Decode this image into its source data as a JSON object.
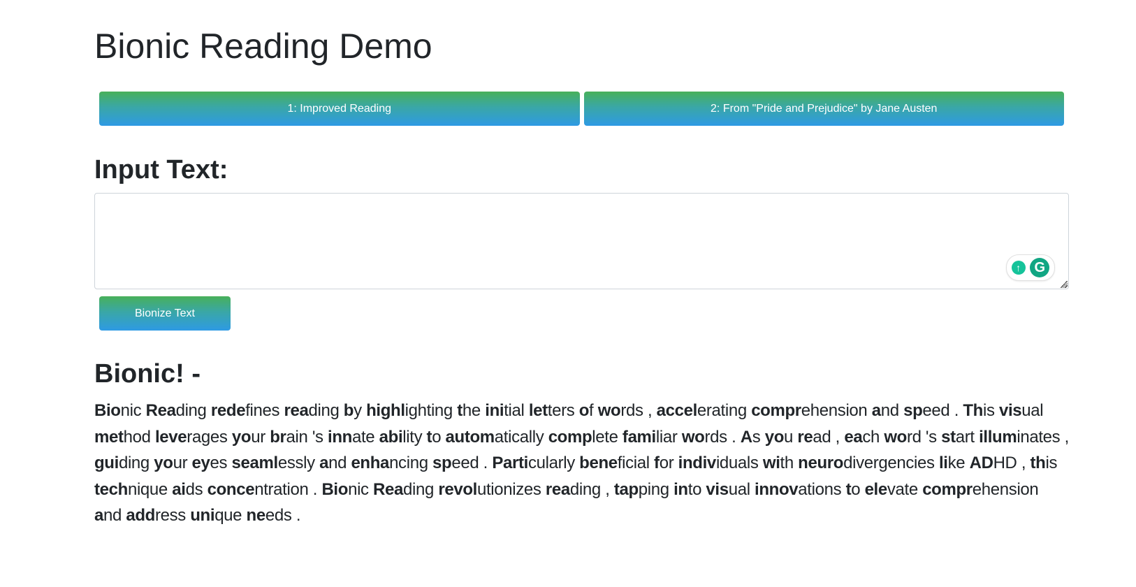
{
  "page": {
    "title": "Bionic Reading Demo"
  },
  "presets": [
    {
      "label": "1: Improved Reading"
    },
    {
      "label": "2: From \"Pride and Prejudice\" by Jane Austen"
    }
  ],
  "input": {
    "heading": "Input Text:",
    "value": "",
    "placeholder": ""
  },
  "grammarly": {
    "bulb_icon": "lightbulb-icon",
    "logo_icon": "grammarly-g-icon",
    "logo_letter": "G",
    "color": "#15c39a"
  },
  "bionize_button": {
    "label": "Bionize Text"
  },
  "output": {
    "heading": "Bionic! -",
    "words": [
      {
        "bold": "Bio",
        "rest": "nic"
      },
      {
        "bold": "Rea",
        "rest": "ding"
      },
      {
        "bold": "rede",
        "rest": "fines"
      },
      {
        "bold": "rea",
        "rest": "ding"
      },
      {
        "bold": "b",
        "rest": "y"
      },
      {
        "bold": "highl",
        "rest": "ighting"
      },
      {
        "bold": "t",
        "rest": "he"
      },
      {
        "bold": "ini",
        "rest": "tial"
      },
      {
        "bold": "let",
        "rest": "ters"
      },
      {
        "bold": "o",
        "rest": "f"
      },
      {
        "bold": "wo",
        "rest": "rds"
      },
      {
        "bold": "",
        "rest": ","
      },
      {
        "bold": "accel",
        "rest": "erating"
      },
      {
        "bold": "compr",
        "rest": "ehension"
      },
      {
        "bold": "a",
        "rest": "nd"
      },
      {
        "bold": "sp",
        "rest": "eed"
      },
      {
        "bold": "",
        "rest": "."
      },
      {
        "bold": "Th",
        "rest": "is"
      },
      {
        "bold": "vis",
        "rest": "ual"
      },
      {
        "bold": "met",
        "rest": "hod"
      },
      {
        "bold": "leve",
        "rest": "rages"
      },
      {
        "bold": "yo",
        "rest": "ur"
      },
      {
        "bold": "br",
        "rest": "ain"
      },
      {
        "bold": "",
        "rest": "'s"
      },
      {
        "bold": "inn",
        "rest": "ate"
      },
      {
        "bold": "abi",
        "rest": "lity"
      },
      {
        "bold": "t",
        "rest": "o"
      },
      {
        "bold": "autom",
        "rest": "atically"
      },
      {
        "bold": "comp",
        "rest": "lete"
      },
      {
        "bold": "fami",
        "rest": "liar"
      },
      {
        "bold": "wo",
        "rest": "rds"
      },
      {
        "bold": "",
        "rest": "."
      },
      {
        "bold": "A",
        "rest": "s"
      },
      {
        "bold": "yo",
        "rest": "u"
      },
      {
        "bold": "re",
        "rest": "ad"
      },
      {
        "bold": "",
        "rest": ","
      },
      {
        "bold": "ea",
        "rest": "ch"
      },
      {
        "bold": "wo",
        "rest": "rd"
      },
      {
        "bold": "",
        "rest": "'s"
      },
      {
        "bold": "st",
        "rest": "art"
      },
      {
        "bold": "illum",
        "rest": "inates"
      },
      {
        "bold": "",
        "rest": ","
      },
      {
        "bold": "gui",
        "rest": "ding"
      },
      {
        "bold": "yo",
        "rest": "ur"
      },
      {
        "bold": "ey",
        "rest": "es"
      },
      {
        "bold": "seaml",
        "rest": "essly"
      },
      {
        "bold": "a",
        "rest": "nd"
      },
      {
        "bold": "enha",
        "rest": "ncing"
      },
      {
        "bold": "sp",
        "rest": "eed"
      },
      {
        "bold": "",
        "rest": "."
      },
      {
        "bold": "Parti",
        "rest": "cularly"
      },
      {
        "bold": "bene",
        "rest": "ficial"
      },
      {
        "bold": "f",
        "rest": "or"
      },
      {
        "bold": "indiv",
        "rest": "iduals"
      },
      {
        "bold": "wi",
        "rest": "th"
      },
      {
        "bold": "neuro",
        "rest": "divergencies"
      },
      {
        "bold": "li",
        "rest": "ke"
      },
      {
        "bold": "AD",
        "rest": "HD"
      },
      {
        "bold": "",
        "rest": ","
      },
      {
        "bold": "th",
        "rest": "is"
      },
      {
        "bold": "tech",
        "rest": "nique"
      },
      {
        "bold": "ai",
        "rest": "ds"
      },
      {
        "bold": "conce",
        "rest": "ntration"
      },
      {
        "bold": "",
        "rest": "."
      },
      {
        "bold": "Bio",
        "rest": "nic"
      },
      {
        "bold": "Rea",
        "rest": "ding"
      },
      {
        "bold": "revol",
        "rest": "utionizes"
      },
      {
        "bold": "rea",
        "rest": "ding"
      },
      {
        "bold": "",
        "rest": ","
      },
      {
        "bold": "tap",
        "rest": "ping"
      },
      {
        "bold": "in",
        "rest": "to"
      },
      {
        "bold": "vis",
        "rest": "ual"
      },
      {
        "bold": "innov",
        "rest": "ations"
      },
      {
        "bold": "t",
        "rest": "o"
      },
      {
        "bold": "ele",
        "rest": "vate"
      },
      {
        "bold": "compr",
        "rest": "ehension"
      },
      {
        "bold": "a",
        "rest": "nd"
      },
      {
        "bold": "add",
        "rest": "ress"
      },
      {
        "bold": "uni",
        "rest": "que"
      },
      {
        "bold": "ne",
        "rest": "eds"
      },
      {
        "bold": "",
        "rest": "."
      }
    ]
  },
  "colors": {
    "button_gradient_top": "#48b05a",
    "button_gradient_bottom": "#2e9ae4",
    "text": "#212529"
  }
}
